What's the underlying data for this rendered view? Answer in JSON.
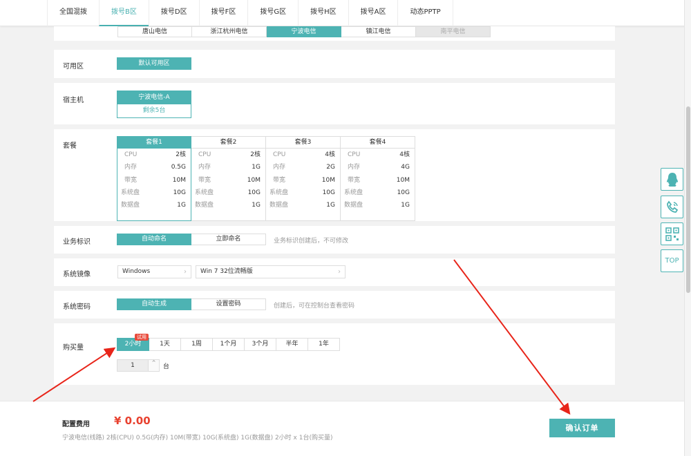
{
  "top_tabs": [
    {
      "label": "全国混拨"
    },
    {
      "label": "拨号B区"
    },
    {
      "label": "拨号D区"
    },
    {
      "label": "拨号F区"
    },
    {
      "label": "拨号G区"
    },
    {
      "label": "拨号H区"
    },
    {
      "label": "拨号A区"
    },
    {
      "label": "动态PPTP"
    }
  ],
  "active_top_tab": "拨号B区",
  "isp_options": [
    "唐山电信",
    "浙江杭州电信",
    "宁波电信",
    "镇江电信",
    "南平电信"
  ],
  "isp_selected": "宁波电信",
  "isp_disabled": "南平电信",
  "zone": {
    "label": "可用区",
    "value": "默认可用区"
  },
  "host": {
    "label": "宿主机",
    "name": "宁波电信-A",
    "remaining": "剩余5台"
  },
  "packages": {
    "label": "套餐",
    "selected": "套餐1",
    "items": [
      {
        "name": "套餐1",
        "specs": [
          {
            "k": "CPU",
            "v": "2核"
          },
          {
            "k": "内存",
            "v": "0.5G"
          },
          {
            "k": "带宽",
            "v": "10M"
          },
          {
            "k": "系统盘",
            "v": "10G"
          },
          {
            "k": "数据盘",
            "v": "1G"
          }
        ]
      },
      {
        "name": "套餐2",
        "specs": [
          {
            "k": "CPU",
            "v": "2核"
          },
          {
            "k": "内存",
            "v": "1G"
          },
          {
            "k": "带宽",
            "v": "10M"
          },
          {
            "k": "系统盘",
            "v": "10G"
          },
          {
            "k": "数据盘",
            "v": "1G"
          }
        ]
      },
      {
        "name": "套餐3",
        "specs": [
          {
            "k": "CPU",
            "v": "4核"
          },
          {
            "k": "内存",
            "v": "2G"
          },
          {
            "k": "带宽",
            "v": "10M"
          },
          {
            "k": "系统盘",
            "v": "10G"
          },
          {
            "k": "数据盘",
            "v": "1G"
          }
        ]
      },
      {
        "name": "套餐4",
        "specs": [
          {
            "k": "CPU",
            "v": "4核"
          },
          {
            "k": "内存",
            "v": "4G"
          },
          {
            "k": "带宽",
            "v": "10M"
          },
          {
            "k": "系统盘",
            "v": "10G"
          },
          {
            "k": "数据盘",
            "v": "1G"
          }
        ]
      }
    ]
  },
  "business_id": {
    "label": "业务标识",
    "opt1": "自动命名",
    "opt2": "立即命名",
    "hint": "业务标识创建后，不可修改"
  },
  "image": {
    "label": "系统镜像",
    "os": "Windows",
    "version": "Win 7 32位流畅版"
  },
  "password": {
    "label": "系统密码",
    "opt1": "自动生成",
    "opt2": "设置密码",
    "hint": "创建后，可在控制台查看密码"
  },
  "purchase": {
    "label": "购买量",
    "durations": [
      "2小时",
      "1天",
      "1周",
      "1个月",
      "3个月",
      "半年",
      "1年"
    ],
    "selected": "2小时",
    "trial_badge": "试用",
    "quantity": "1",
    "unit": "台"
  },
  "footer": {
    "label": "配置费用",
    "price": "¥ 0.00",
    "summary": "宁波电信(线路) 2核(CPU) 0.5G(内存) 10M(带宽) 10G(系统盘) 1G(数据盘) 2小时 x 1台(购买量)",
    "confirm": "确认订单"
  },
  "side_tools": {
    "top": "TOP"
  },
  "colors": {
    "accent": "#4db3b3",
    "price": "#e8412f",
    "annotation_arrow": "#e8251a"
  }
}
